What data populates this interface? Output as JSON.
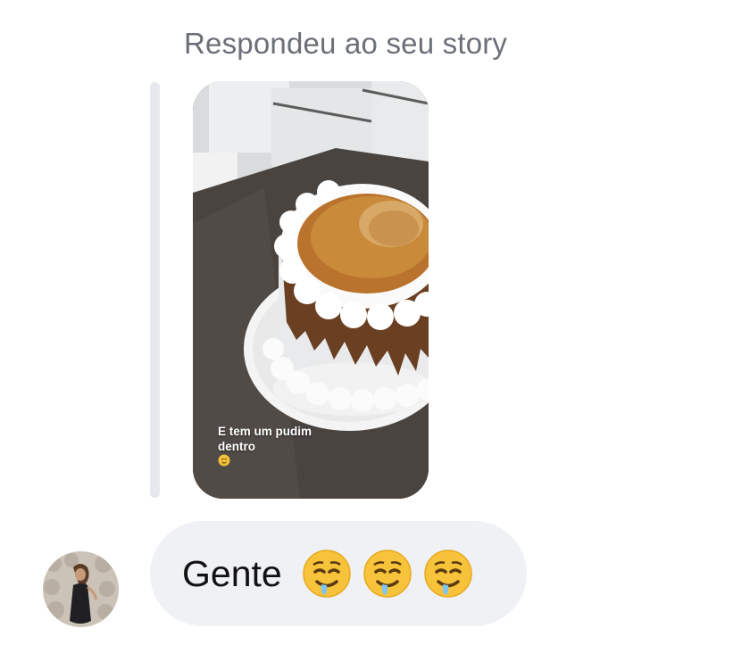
{
  "reply_header": "Respondeu ao seu story",
  "story": {
    "caption_line1": "E tem um pudim",
    "caption_line2": "dentro",
    "caption_emoji": "drooling-face-emoji"
  },
  "message": {
    "text": "Gente",
    "emojis": [
      "drooling-face-emoji",
      "drooling-face-emoji",
      "drooling-face-emoji"
    ]
  },
  "avatar": {
    "icon": "user-avatar-photo"
  },
  "colors": {
    "bubble_bg": "#eff1f4",
    "quote_bar": "#e6e9ee",
    "header_text": "#6b6f78"
  }
}
